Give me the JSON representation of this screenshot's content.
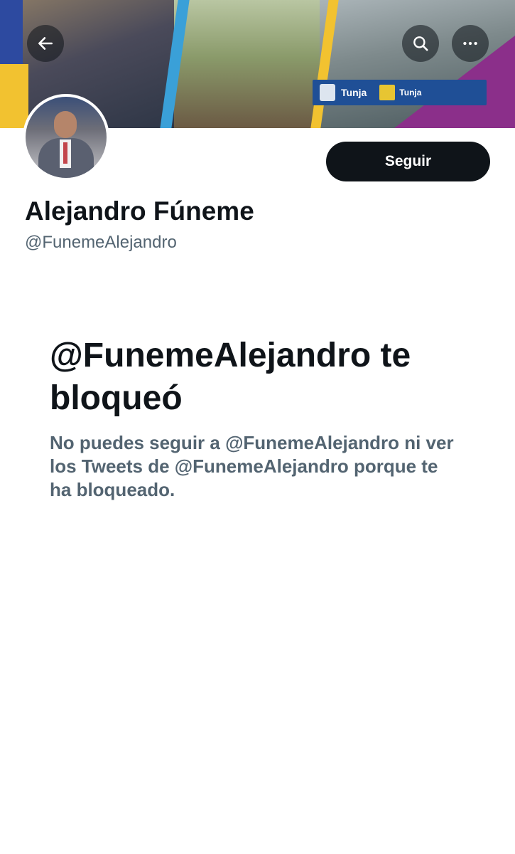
{
  "header": {
    "banner_logo_left": "Tunja",
    "banner_logo_right": "Tunja",
    "back_icon": "arrow-left-icon",
    "search_icon": "search-icon",
    "more_icon": "more-horizontal-icon"
  },
  "profile": {
    "display_name": "Alejandro Fúneme",
    "handle": "@FunemeAlejandro",
    "follow_label": "Seguir"
  },
  "blocked": {
    "title": "@FunemeAlejandro te bloqueó",
    "message": "No puedes seguir a @FunemeAlejandro ni ver los Tweets de @FunemeAlejandro porque te ha bloqueado."
  },
  "colors": {
    "primary_text": "#0f1419",
    "secondary_text": "#536471",
    "button_bg": "#0f1419"
  }
}
